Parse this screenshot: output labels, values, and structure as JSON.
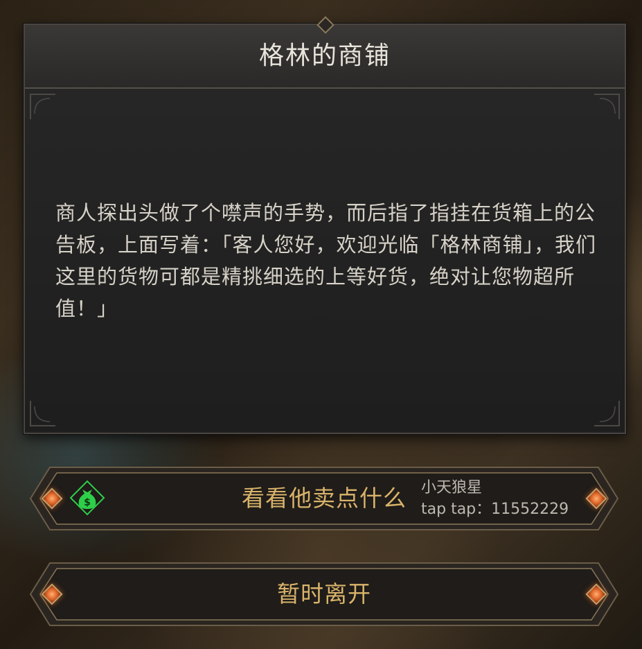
{
  "dialog": {
    "title": "格林的商铺",
    "message": "商人探出头做了个噤声的手势，而后指了指挂在货箱上的公告板，上面写着：「客人您好，欢迎光临「格林商铺」，我们这里的货物可都是精挑细选的上等好货，绝对让您物超所值！」"
  },
  "options": [
    {
      "label": "看看他卖点什么",
      "icon": "money-bag-icon"
    },
    {
      "label": "暂时离开"
    }
  ],
  "watermark": {
    "line1": "小天狼星",
    "line2": "tap tap：11552229"
  },
  "colors": {
    "option_text": "#d9b36a",
    "title_text": "#e8e4dc",
    "body_text": "#d7d2c8",
    "money_icon": "#2fcf4a"
  }
}
